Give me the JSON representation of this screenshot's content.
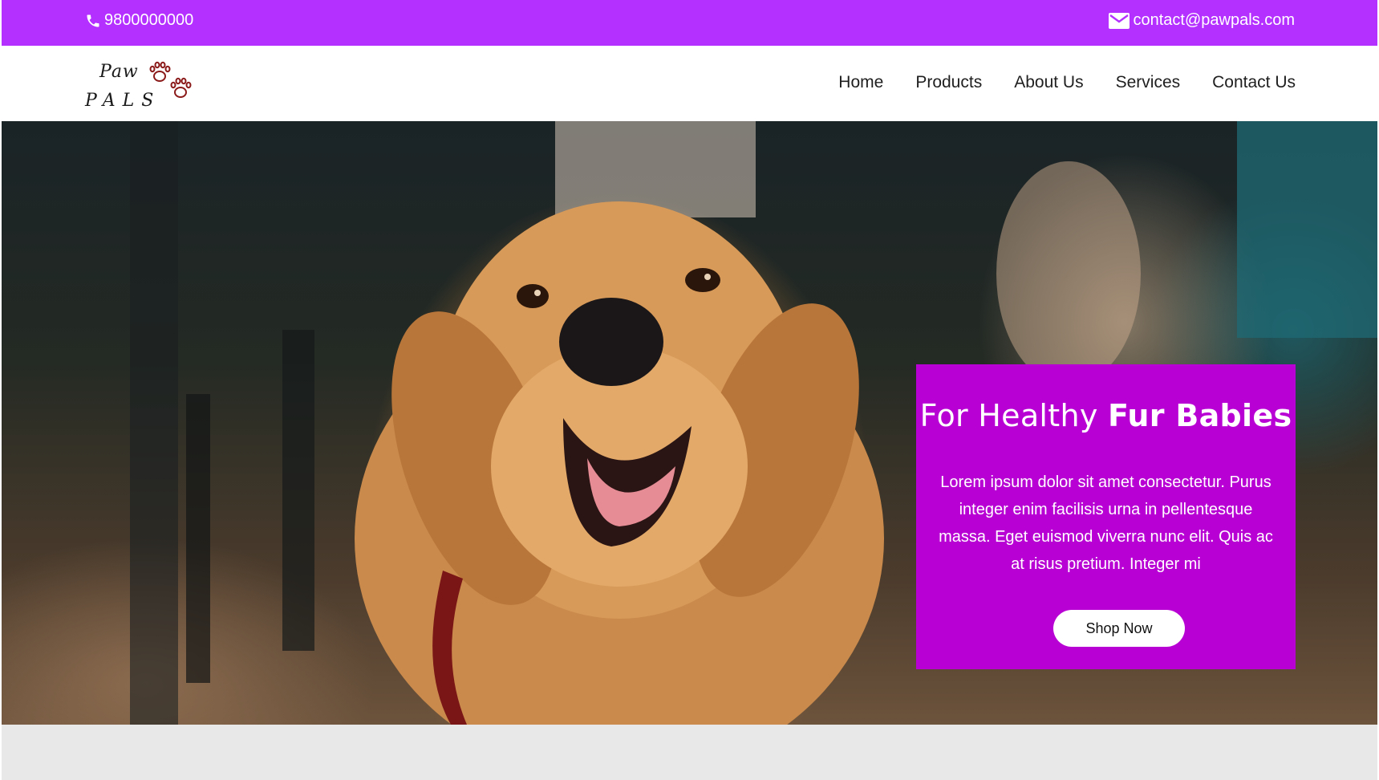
{
  "topbar": {
    "phone": "9800000000",
    "email": "contact@pawpals.com",
    "phone_icon": "phone-icon",
    "email_icon": "envelope-icon",
    "background": "#b430ff"
  },
  "logo": {
    "line1": "Paw",
    "line2": "PALS",
    "paw_icon": "paw-print-icon",
    "paw_color": "#8b1a1a"
  },
  "nav": {
    "items": [
      {
        "label": "Home"
      },
      {
        "label": "Products"
      },
      {
        "label": "About Us"
      },
      {
        "label": "Services"
      },
      {
        "label": "Contact Us"
      }
    ]
  },
  "hero": {
    "image": "golden-retriever-photo",
    "title_regular": "For Healthy ",
    "title_bold": "Fur Babies",
    "body": "Lorem ipsum dolor sit amet consectetur. Purus integer enim facilisis urna in pellentesque massa. Eget euismod viverra nunc elit. Quis ac at risus pretium. Integer mi",
    "cta_label": "Shop Now",
    "panel_color": "#b800d4"
  }
}
